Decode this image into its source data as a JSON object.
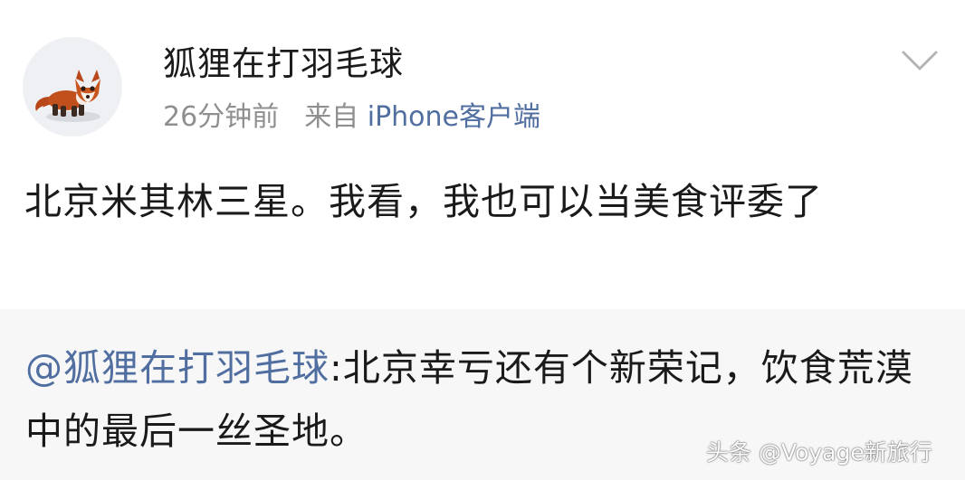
{
  "post": {
    "author": {
      "name": "狐狸在打羽毛球",
      "avatar_icon": "fox-avatar-icon"
    },
    "time": "26分钟前",
    "source_prefix": "来自",
    "source": "iPhone客户端",
    "menu_icon": "chevron-down-icon",
    "text": "北京米其林三星。我看，我也可以当美食评委了"
  },
  "quote": {
    "mention": "@狐狸在打羽毛球",
    "text": ":北京幸亏还有个新荣记，饮食荒漠中的最后一丝圣地。"
  },
  "watermark": {
    "text": "头条 @Voyage新旅行"
  },
  "colors": {
    "link": "#506ea0",
    "meta": "#8f8f8f",
    "quote_background": "#f7f7f7",
    "text": "#1a1a1a"
  }
}
